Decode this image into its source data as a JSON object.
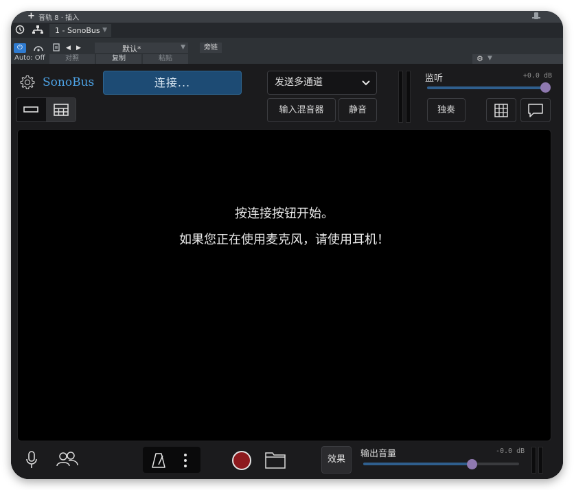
{
  "host": {
    "title": "音轨 8 · 插入",
    "insert_slot": "1 - SonoBus",
    "auto_mode": "Auto: Off",
    "preset": "默认*",
    "bypass_label": "旁链",
    "compare_label": "对照",
    "copy_label": "复制",
    "paste_label": "粘贴"
  },
  "plugin": {
    "brand": "SonoBus",
    "connect_label": "连接...",
    "send_mode": "发送多通道",
    "input_mixer_label": "输入混音器",
    "mute_label": "静音",
    "monitor": {
      "label": "监听",
      "db_text": "+0.0 dB",
      "level_fraction": 1.0
    },
    "solo_label": "独奏",
    "message_line1": "按连接按钮开始。",
    "message_line2": "如果您正在使用麦克风，请使用耳机！",
    "effects_label": "效果",
    "output": {
      "label": "输出音量",
      "db_text": "-0.0 dB",
      "level_fraction": 0.69
    },
    "colors": {
      "accent": "#4da3e6",
      "connect_bg": "#1d4b74",
      "slider_knob": "#8f79b0",
      "record": "#8d1a1e"
    },
    "icons": [
      "gear-icon",
      "single-view-icon",
      "grid-view-icon",
      "keyboard-icon",
      "chat-icon",
      "microphone-icon",
      "users-icon",
      "metronome-icon",
      "more-icon",
      "record-icon",
      "folder-icon"
    ]
  }
}
